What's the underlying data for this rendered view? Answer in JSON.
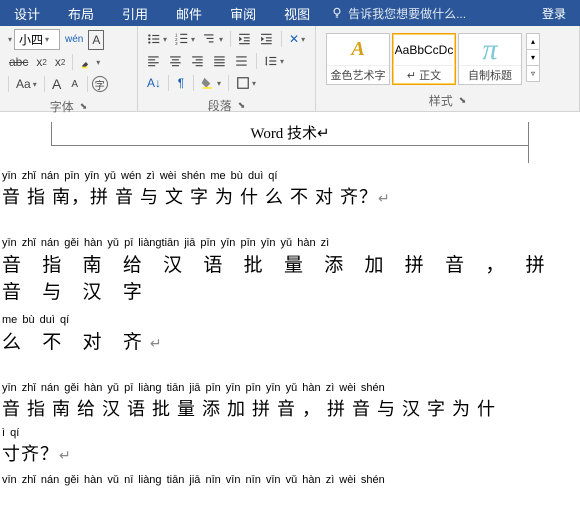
{
  "tabs": {
    "design": "设计",
    "layout": "布局",
    "references": "引用",
    "mail": "邮件",
    "review": "审阅",
    "view": "视图"
  },
  "tell_me": {
    "placeholder": "告诉我您想要做什么..."
  },
  "sign_in": "登录",
  "font_group": {
    "label": "字体",
    "size_value": "小四",
    "wen": "wén",
    "a_outline": "A",
    "aa_case": "Aa",
    "a_big": "A",
    "a_small": "A",
    "clear": "字"
  },
  "para_group": {
    "label": "段落"
  },
  "styles_group": {
    "label": "样式",
    "items": [
      {
        "preview": "A",
        "label": "金色艺术字",
        "class": "gold"
      },
      {
        "preview": "AaBbCcDc",
        "label": "↵ 正文",
        "class": ""
      },
      {
        "preview": "π",
        "label": "自制标题",
        "class": "cyan-tile"
      }
    ]
  },
  "doc": {
    "title": "Word 技术↵",
    "p1": {
      "pinyin": "yīn zhǐ nán     pīn yīn yǔ wén  zì wèi shén me bù duì qí",
      "text": "音 指 南，拼 音 与 文 字 为 什 么 不 对 齐？"
    },
    "p2a": {
      "pinyin": "yīn zhǐ nán gěi hàn yǔ   pī  liàngtiān  jiā pīn yīn          pīn yīn  yǔ  hàn  zì",
      "text": "音 指 南 给 汉 语 批  量  添  加 拼 音 ，   拼 音 与 汉 字"
    },
    "p2b": {
      "pinyin": "me  bù  duì  qí",
      "text": "么 不 对 齐"
    },
    "p3a": {
      "pinyin": "yīn zhǐ nán gěi hàn yǔ pī liàng tiān jiā pīn yīn     pīn yīn yǔ hàn zì wèi shén",
      "text": "音 指 南 给 汉 语 批  量   添 加 拼 音 ， 拼 音 与 汉 字 为 什"
    },
    "p3b": {
      "pinyin": "ì qí",
      "text": "寸齐？"
    },
    "p4": {
      "pinyin": "vīn zhǐ nán gěi hàn vǔ  nī liàng tiān jiā nīn vīn      nīn vīn vǔ hàn zì wèi shén"
    }
  }
}
